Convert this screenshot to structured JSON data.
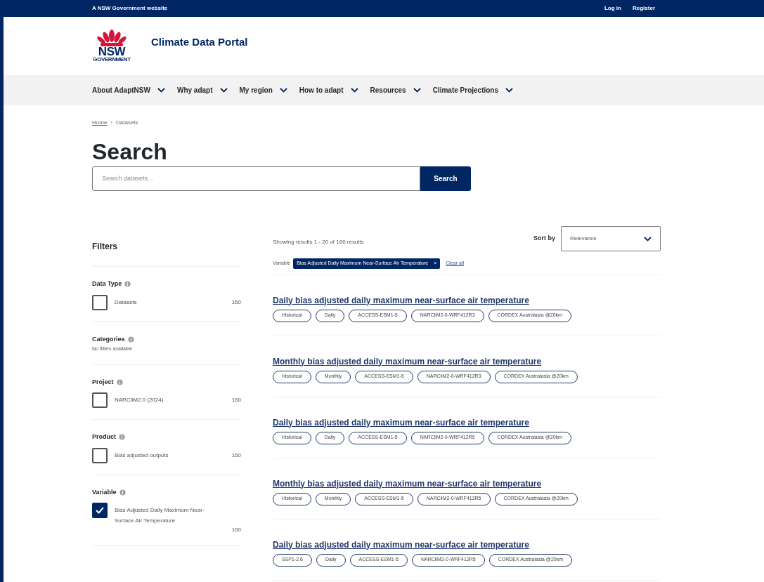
{
  "top_bar": {
    "notice": "A NSW Government website",
    "links": [
      "Log in",
      "Register"
    ]
  },
  "header": {
    "logo_word": "NSW",
    "logo_sub": "GOVERNMENT",
    "site_title": "Climate Data Portal"
  },
  "nav": [
    "About AdaptNSW",
    "Why adapt",
    "My region",
    "How to adapt",
    "Resources",
    "Climate Projections"
  ],
  "breadcrumb": [
    {
      "label": "Home",
      "kind": "link"
    },
    {
      "label": "Datasets",
      "kind": "current",
      "separator": "›"
    }
  ],
  "page_title": "Search",
  "search": {
    "placeholder": "Search datasets...",
    "button": "Search"
  },
  "filters": {
    "title": "Filters",
    "sections": [
      {
        "title": "Data Type",
        "options": [
          {
            "label": "Datasets",
            "count": "160",
            "checked": false
          }
        ]
      },
      {
        "title": "Categories",
        "empty_text": "No filters available"
      },
      {
        "title": "Project",
        "options": [
          {
            "label": "NARCliM2.0 (2024)",
            "count": "160",
            "checked": false
          }
        ]
      },
      {
        "title": "Product",
        "options": [
          {
            "label": "Bias adjusted outputs",
            "count": "160",
            "checked": false
          }
        ]
      },
      {
        "title": "Variable",
        "options": [
          {
            "label": "Bias Adjusted Daily Maximum Near-Surface Air Temperature",
            "count": "160",
            "checked": true
          }
        ]
      }
    ]
  },
  "results": {
    "summary": "Showing results 1 - 20 of 160 results",
    "sort_label": "Sort by",
    "sort_value": "Relevance",
    "active_filter": {
      "label": "Variable",
      "value": "Bias Adjusted Daily Maximum Near-Surface Air Temperature",
      "remove": "×"
    },
    "clear_all": "Clear all",
    "items": [
      {
        "title": "Daily bias adjusted daily maximum near-surface air temperature",
        "tags": [
          "Historical",
          "Daily",
          "ACCESS-ESM1-5",
          "NARCliM2-0-WRF412R3",
          "CORDEX Australasia @20km"
        ]
      },
      {
        "title": "Monthly bias adjusted daily maximum near-surface air temperature",
        "tags": [
          "Historical",
          "Monthly",
          "ACCESS-ESM1-5",
          "NARCliM2-0-WRF412R3",
          "CORDEX Australasia @20km"
        ]
      },
      {
        "title": "Daily bias adjusted daily maximum near-surface air temperature",
        "tags": [
          "Historical",
          "Daily",
          "ACCESS-ESM1-5",
          "NARCliM2-0-WRF412R5",
          "CORDEX Australasia @20km"
        ]
      },
      {
        "title": "Monthly bias adjusted daily maximum near-surface air temperature",
        "tags": [
          "Historical",
          "Monthly",
          "ACCESS-ESM1-5",
          "NARCliM2-0-WRF412R5",
          "CORDEX Australasia @20km"
        ]
      },
      {
        "title": "Daily bias adjusted daily maximum near-surface air temperature",
        "tags": [
          "SSP1-2.6",
          "Daily",
          "ACCESS-ESM1-5",
          "NARCliM2-0-WRF412R5",
          "CORDEX Australasia @20km"
        ]
      }
    ]
  }
}
